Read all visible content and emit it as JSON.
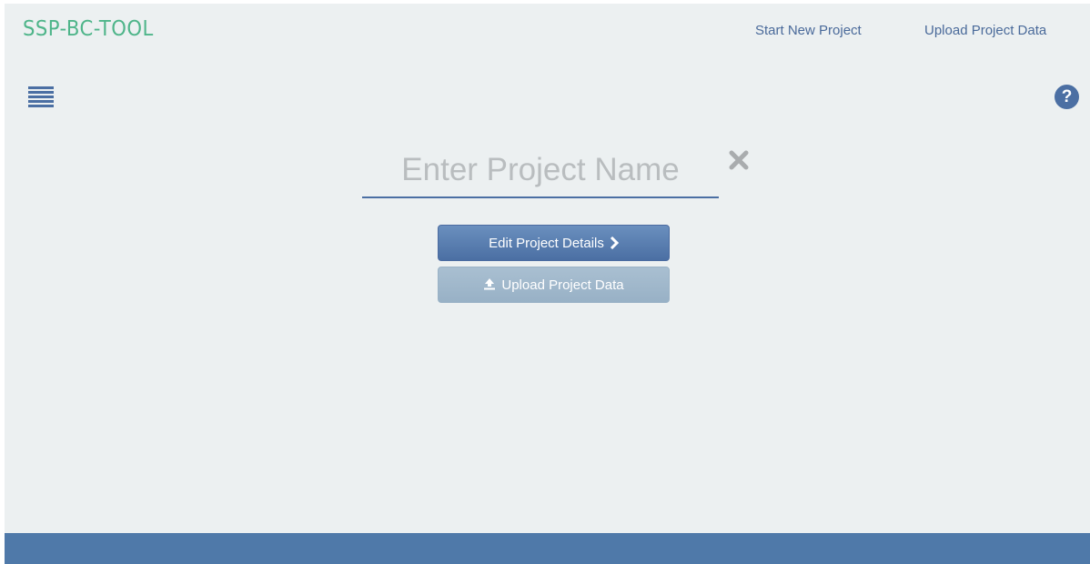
{
  "header": {
    "brand": "SSP-BC-TOOL",
    "nav": {
      "start_new_project": "Start New Project",
      "upload_project_data": "Upload Project Data"
    }
  },
  "toolbar": {
    "menu_icon": "hamburger-menu-icon",
    "help_icon": "question-circle-icon",
    "help_glyph": "?"
  },
  "project_form": {
    "name_input": {
      "placeholder": "Enter Project Name",
      "value": ""
    },
    "clear_icon": "close-x-icon",
    "edit_button_label": "Edit Project Details",
    "upload_button_label": "Upload Project Data"
  },
  "colors": {
    "brand": "#4fb58a",
    "primary": "#4b6fa3",
    "primary_disabled": "#9ab2c6",
    "background": "#ecf0f1",
    "footer": "#4f79a9"
  }
}
